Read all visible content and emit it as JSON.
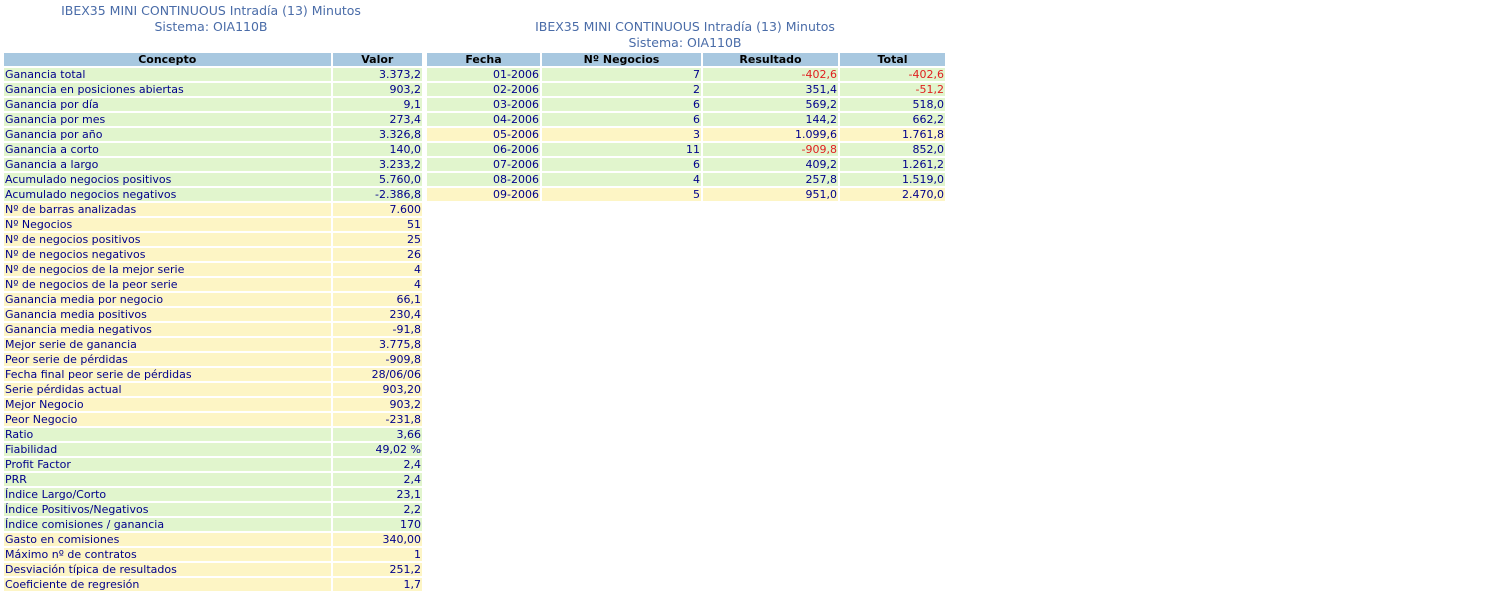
{
  "left_title": {
    "line1": "IBEX35 MINI CONTINUOUS Intradía (13) Minutos",
    "line2": "Sistema: OIA110B"
  },
  "right_title": {
    "line1": "IBEX35 MINI CONTINUOUS Intradía (13) Minutos",
    "line2": "Sistema: OIA110B"
  },
  "stats_table": {
    "headers": [
      "Concepto",
      "Valor"
    ],
    "rows": [
      {
        "label": "Ganancia total",
        "value": "3.373,2",
        "color": "green"
      },
      {
        "label": "Ganancia en posiciones abiertas",
        "value": "903,2",
        "color": "green"
      },
      {
        "label": "Ganancia por día",
        "value": "9,1",
        "color": "green"
      },
      {
        "label": "Ganancia por mes",
        "value": "273,4",
        "color": "green"
      },
      {
        "label": "Ganancia por año",
        "value": "3.326,8",
        "color": "green"
      },
      {
        "label": "Ganancia a corto",
        "value": "140,0",
        "color": "green"
      },
      {
        "label": "Ganancia a largo",
        "value": "3.233,2",
        "color": "green"
      },
      {
        "label": "Acumulado negocios positivos",
        "value": "5.760,0",
        "color": "green"
      },
      {
        "label": "Acumulado negocios negativos",
        "value": "-2.386,8",
        "color": "green"
      },
      {
        "label": "Nº de barras analizadas",
        "value": "7.600",
        "color": "yellow"
      },
      {
        "label": "Nº Negocios",
        "value": "51",
        "color": "yellow"
      },
      {
        "label": "Nº de negocios positivos",
        "value": "25",
        "color": "yellow"
      },
      {
        "label": "Nº de negocios negativos",
        "value": "26",
        "color": "yellow"
      },
      {
        "label": "Nº de negocios de la mejor serie",
        "value": "4",
        "color": "yellow"
      },
      {
        "label": "Nº de negocios de la peor serie",
        "value": "4",
        "color": "yellow"
      },
      {
        "label": "Ganancia media por negocio",
        "value": "66,1",
        "color": "yellow"
      },
      {
        "label": "Ganancia media positivos",
        "value": "230,4",
        "color": "yellow"
      },
      {
        "label": "Ganancia media negativos",
        "value": "-91,8",
        "color": "yellow"
      },
      {
        "label": "Mejor serie de ganancia",
        "value": "3.775,8",
        "color": "yellow"
      },
      {
        "label": "Peor serie de pérdidas",
        "value": "-909,8",
        "color": "yellow"
      },
      {
        "label": "Fecha final peor serie de pérdidas",
        "value": "28/06/06",
        "color": "yellow"
      },
      {
        "label": "Serie pérdidas actual",
        "value": "903,20",
        "color": "yellow"
      },
      {
        "label": "Mejor Negocio",
        "value": "903,2",
        "color": "yellow"
      },
      {
        "label": "Peor Negocio",
        "value": "-231,8",
        "color": "yellow"
      },
      {
        "label": "Ratio",
        "value": "3,66",
        "color": "green"
      },
      {
        "label": "Fiabilidad",
        "value": "49,02 %",
        "color": "green"
      },
      {
        "label": "Profit Factor",
        "value": "2,4",
        "color": "green"
      },
      {
        "label": "PRR",
        "value": "2,4",
        "color": "green"
      },
      {
        "label": "Índice Largo/Corto",
        "value": "23,1",
        "color": "green"
      },
      {
        "label": "Índice Positivos/Negativos",
        "value": "2,2",
        "color": "green"
      },
      {
        "label": "Índice comisiones / ganancia",
        "value": "170",
        "color": "green"
      },
      {
        "label": "Gasto en comisiones",
        "value": "340,00",
        "color": "yellow"
      },
      {
        "label": "Máximo nº de contratos",
        "value": "1",
        "color": "yellow"
      },
      {
        "label": "Desviación típica de resultados",
        "value": "251,2",
        "color": "yellow"
      },
      {
        "label": "Coeficiente de regresión",
        "value": "1,7",
        "color": "yellow"
      }
    ]
  },
  "monthly_table": {
    "headers": [
      "Fecha",
      "Nº Negocios",
      "Resultado",
      "Total"
    ],
    "rows": [
      {
        "fecha": "01-2006",
        "negocios": "7",
        "resultado": "-402,6",
        "total": "-402,6",
        "color": "green"
      },
      {
        "fecha": "02-2006",
        "negocios": "2",
        "resultado": "351,4",
        "total": "-51,2",
        "color": "green"
      },
      {
        "fecha": "03-2006",
        "negocios": "6",
        "resultado": "569,2",
        "total": "518,0",
        "color": "green"
      },
      {
        "fecha": "04-2006",
        "negocios": "6",
        "resultado": "144,2",
        "total": "662,2",
        "color": "green"
      },
      {
        "fecha": "05-2006",
        "negocios": "3",
        "resultado": "1.099,6",
        "total": "1.761,8",
        "color": "yellow"
      },
      {
        "fecha": "06-2006",
        "negocios": "11",
        "resultado": "-909,8",
        "total": "852,0",
        "color": "green"
      },
      {
        "fecha": "07-2006",
        "negocios": "6",
        "resultado": "409,2",
        "total": "1.261,2",
        "color": "green"
      },
      {
        "fecha": "08-2006",
        "negocios": "4",
        "resultado": "257,8",
        "total": "1.519,0",
        "color": "green"
      },
      {
        "fecha": "09-2006",
        "negocios": "5",
        "resultado": "951,0",
        "total": "2.470,0",
        "color": "yellow"
      }
    ]
  },
  "colors": {
    "header_bg": "#a8c8e0",
    "green_row": "#e1f5cd",
    "yellow_row": "#fdf5c5",
    "text": "#00008b",
    "title": "#4a6ca8",
    "negative": "#e02020"
  }
}
